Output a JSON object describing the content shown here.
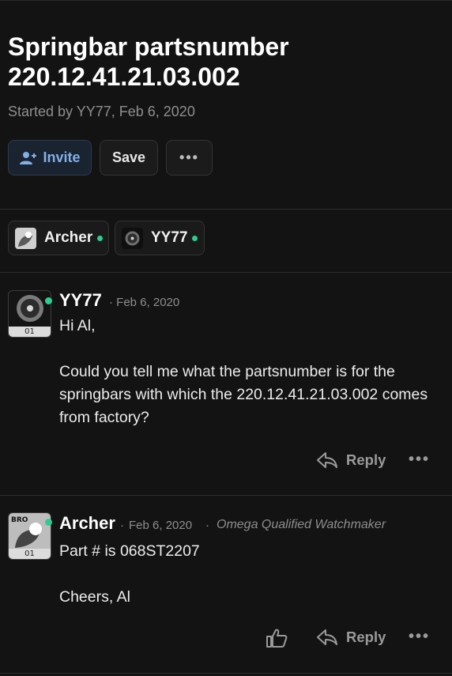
{
  "thread": {
    "title": "Springbar partsnumber 220.12.41.21.03.002",
    "started_by": "Started by YY77, Feb 6, 2020"
  },
  "actions": {
    "invite_label": "Invite",
    "save_label": "Save",
    "more_label": "•••"
  },
  "participants": [
    {
      "name": "Archer",
      "online": true
    },
    {
      "name": "YY77",
      "online": true
    }
  ],
  "posts": [
    {
      "author": "YY77",
      "date": "· Feb 6, 2020",
      "badge": "01",
      "lines": [
        "Hi Al,",
        "",
        "Could you tell me what the partsnumber is for the springbars with which the 220.12.41.21.03.002 comes from factory?"
      ],
      "reply_label": "Reply"
    },
    {
      "author": "Archer",
      "date": "Feb 6, 2020",
      "sep": "·",
      "role": "Omega Qualified Watchmaker",
      "badge": "01",
      "avatar_text": "BRO",
      "lines": [
        "Part # is 068ST2207",
        "",
        "Cheers, Al"
      ],
      "reply_label": "Reply"
    }
  ],
  "colors": {
    "background": "#131313",
    "online": "#2ecc8f",
    "invite_accent": "#7fb0e8"
  }
}
